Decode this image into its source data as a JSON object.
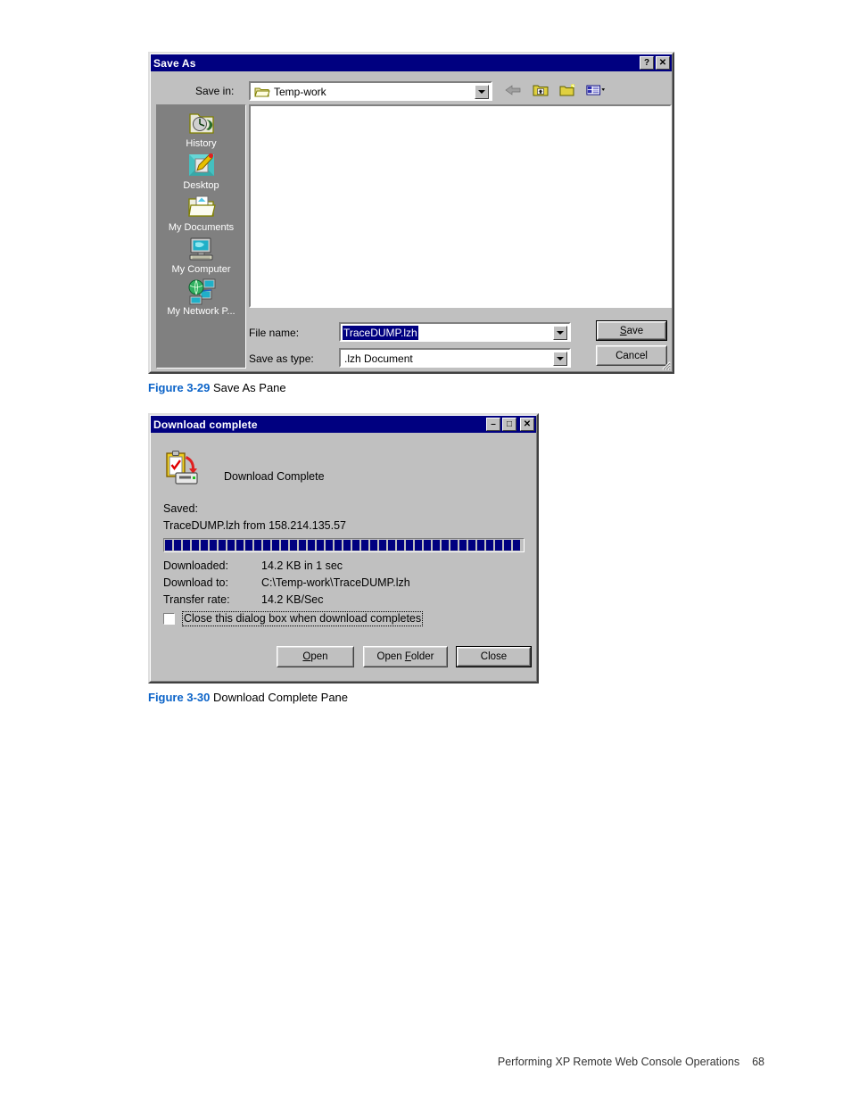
{
  "save_as_dialog": {
    "title": "Save As",
    "title_buttons": [
      {
        "name": "help-button",
        "glyph": "?"
      },
      {
        "name": "close-button",
        "glyph": "✕"
      }
    ],
    "save_in_label": "Save in:",
    "save_in_value": "Temp-work",
    "toolbar_icons": [
      "back-icon",
      "up-one-level-icon",
      "new-folder-icon",
      "views-icon"
    ],
    "places": [
      {
        "label": "History",
        "icon": "history-folder-icon"
      },
      {
        "label": "Desktop",
        "icon": "desktop-icon"
      },
      {
        "label": "My Documents",
        "icon": "my-documents-icon"
      },
      {
        "label": "My Computer",
        "icon": "my-computer-icon"
      },
      {
        "label": "My Network P...",
        "icon": "my-network-places-icon"
      }
    ],
    "file_name_label": "File name:",
    "file_name_value": "TraceDUMP.lzh",
    "save_as_type_label": "Save as type:",
    "save_as_type_value": ".lzh Document",
    "save_button": "Save",
    "cancel_button": "Cancel"
  },
  "download_complete_dialog": {
    "title": "Download complete",
    "title_buttons": [
      {
        "name": "minimize-button",
        "glyph": "–"
      },
      {
        "name": "maximize-button",
        "glyph": "□"
      },
      {
        "name": "close-button",
        "glyph": "✕"
      }
    ],
    "icon": "download-complete-icon",
    "heading": "Download Complete",
    "saved_label": "Saved:",
    "saved_value": "TraceDUMP.lzh  from  158.214.135.57",
    "progress_percent": 100,
    "rows": [
      {
        "label": "Downloaded:",
        "value": "14.2 KB in 1 sec"
      },
      {
        "label": "Download to:",
        "value": "C:\\Temp-work\\TraceDUMP.lzh"
      },
      {
        "label": "Transfer rate:",
        "value": "14.2 KB/Sec"
      }
    ],
    "checkbox_label": "Close this dialog box when download completes",
    "checkbox_checked": false,
    "open_button": "Open",
    "open_folder_button": "Open Folder",
    "close_button": "Close"
  },
  "captions": {
    "fig29_num": "Figure 3-29",
    "fig29_text": " Save As Pane",
    "fig30_num": "Figure 3-30",
    "fig30_text": " Download Complete Pane"
  },
  "footer": {
    "text": "Performing XP Remote Web Console Operations",
    "page": "68"
  },
  "colors": {
    "titlebar": "#000080",
    "face": "#c0c0c0",
    "progress": "#000080",
    "caption_accent": "#0b63c8"
  }
}
